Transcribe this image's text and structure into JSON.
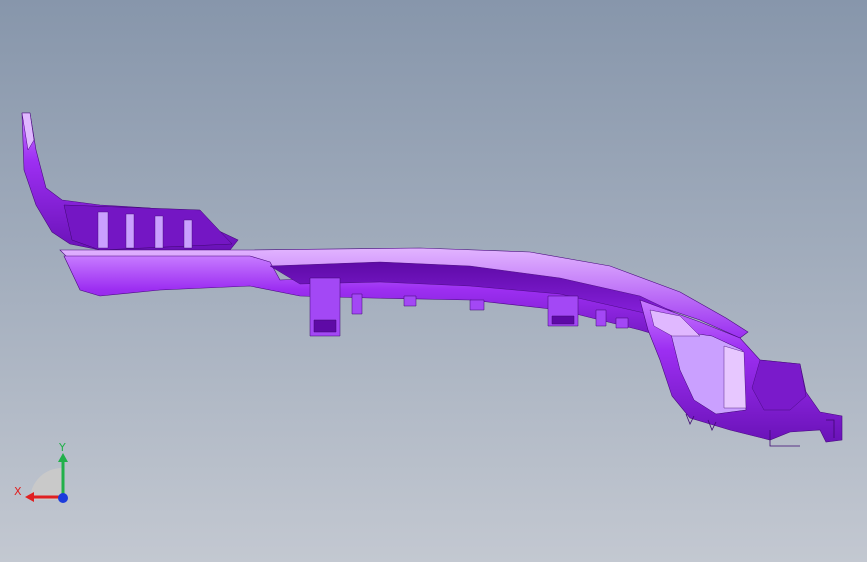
{
  "viewport": {
    "background_top": "#8796ab",
    "background_bottom": "#c3c8d1",
    "model_color": "#9b2cf0",
    "model_shade": "#6a0fb8",
    "model_highlight": "#d9a6ff"
  },
  "triad": {
    "x_label": "X",
    "y_label": "Y",
    "x_color": "#e02020",
    "y_color": "#21b04a",
    "z_color": "#1c3cdc"
  }
}
